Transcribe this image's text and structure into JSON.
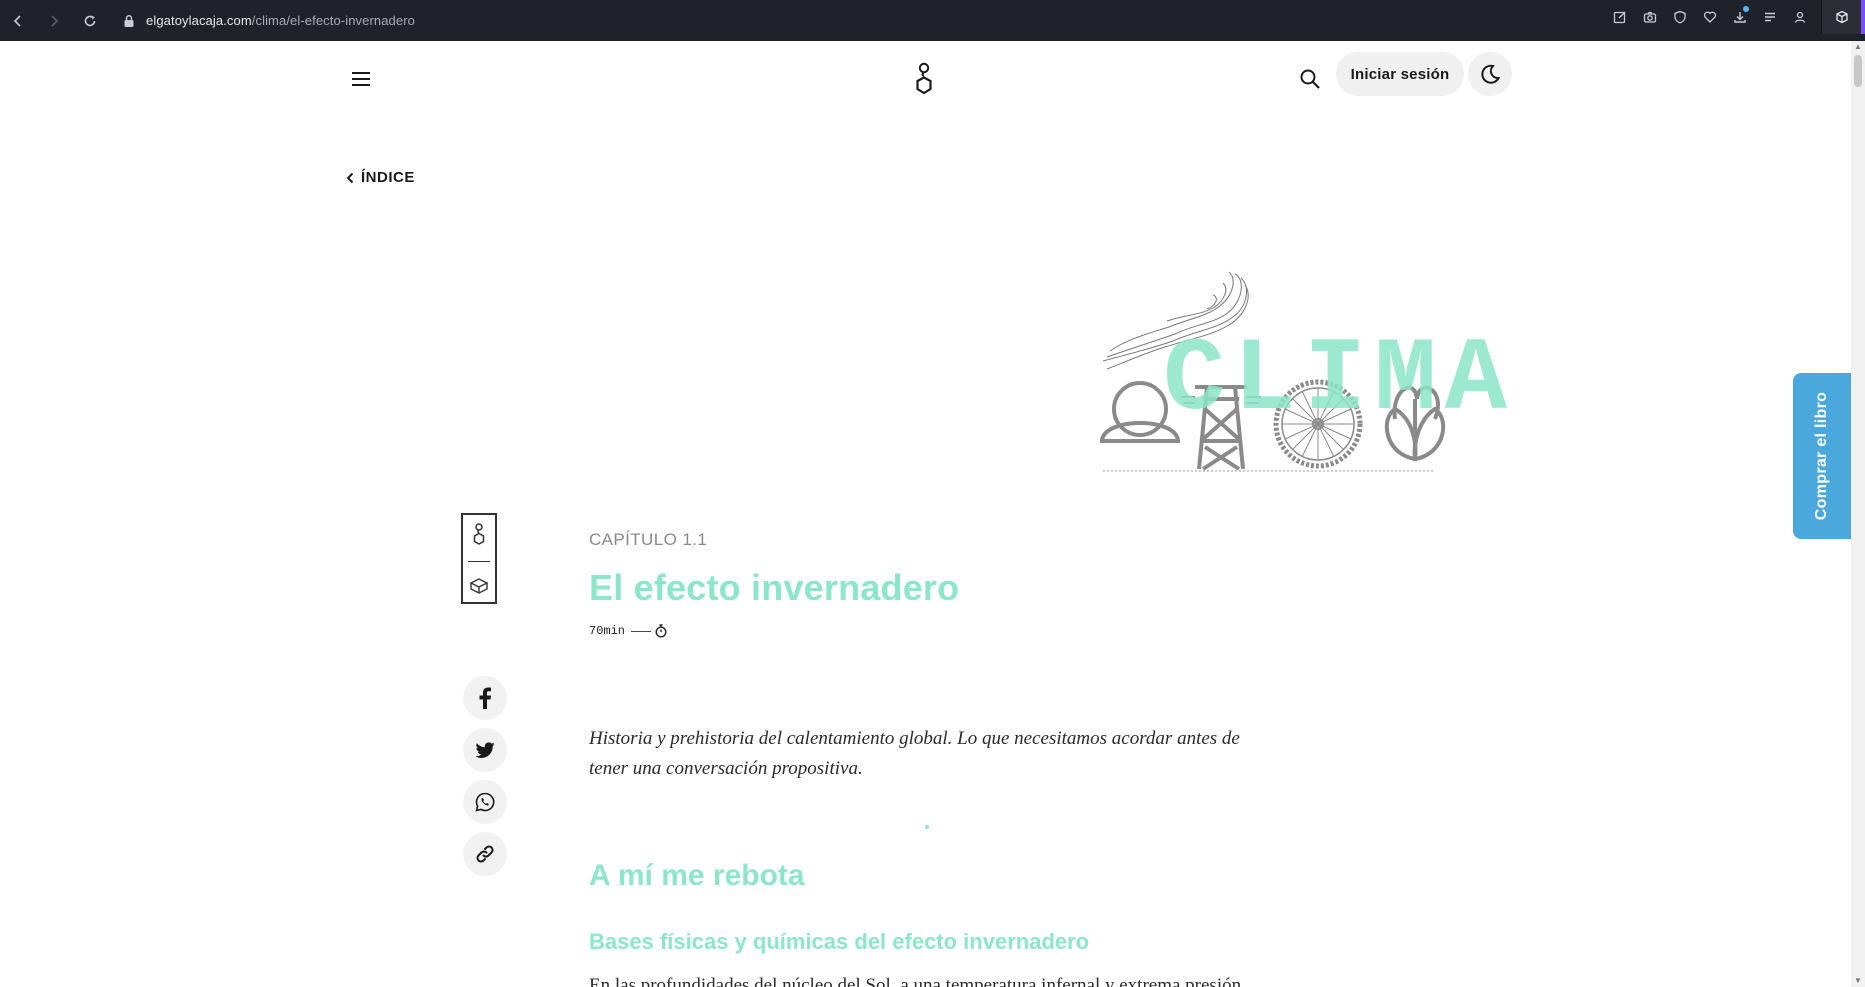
{
  "browser": {
    "url_domain": "elgatoylacaja.com",
    "url_path": "/clima/el-efecto-invernadero"
  },
  "header": {
    "login_label": "Iniciar sesión"
  },
  "nav": {
    "index_label": "ÍNDICE"
  },
  "hero": {
    "word": "CLIMA"
  },
  "article": {
    "chapter": "CAPÍTULO 1.1",
    "title": "El efecto invernadero",
    "read_time": "70min",
    "lead": "Historia y prehistoria del calentamiento global. Lo que necesitamos acordar antes de tener una conversación propositiva.",
    "section_title": "A mí me rebota",
    "subsection_title": "Bases físicas y químicas del efecto invernadero",
    "body": "En las profundidades del núcleo del Sol, a una temperatura infernal y extrema presión, cientos de millones de toneladas de protones chocan constante y"
  },
  "buy_tab": {
    "label": "Comprar el libro"
  },
  "colors": {
    "accent": "#8ce6c8",
    "buy": "#4aa8dc"
  }
}
